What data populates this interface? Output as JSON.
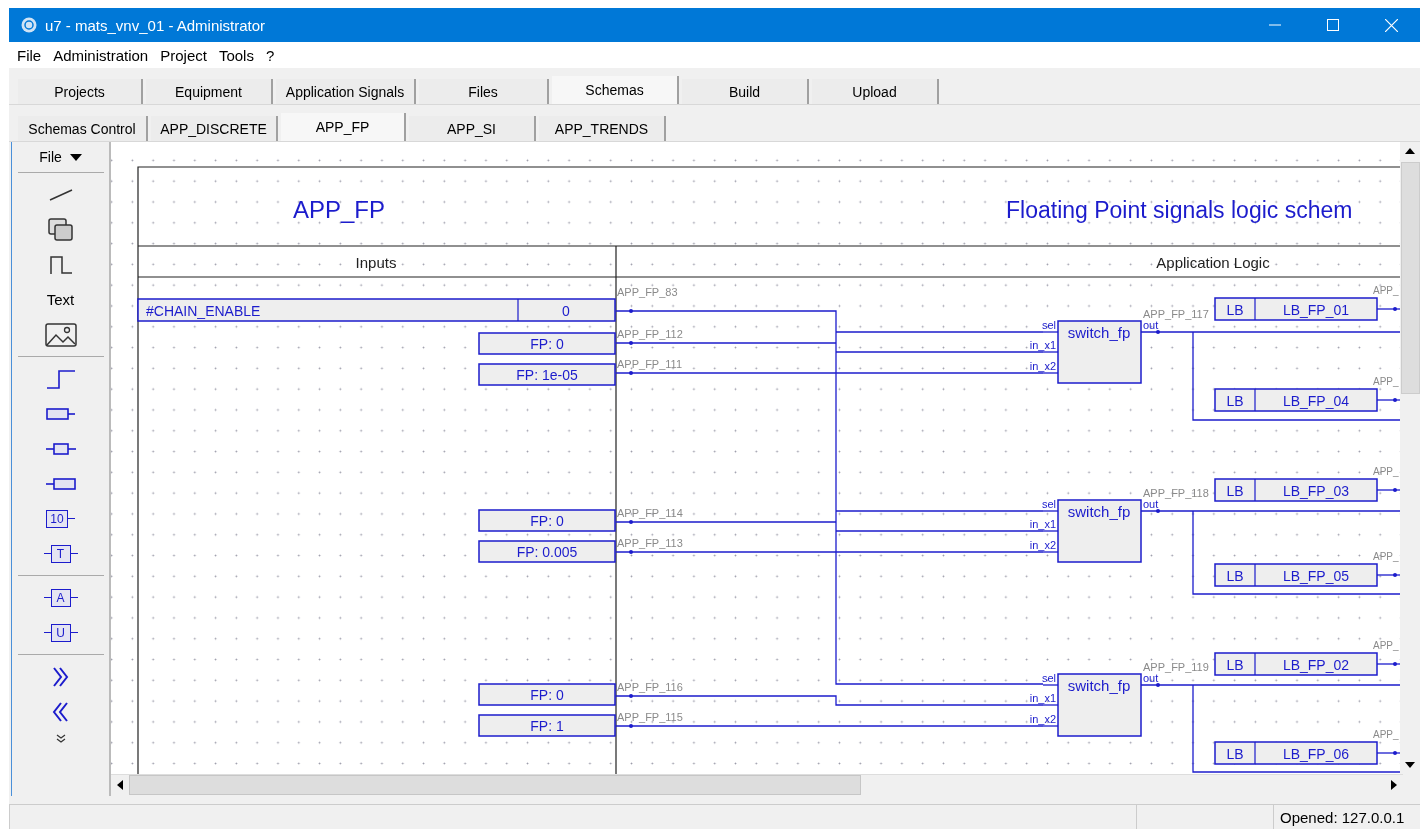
{
  "window": {
    "title": "u7 - mats_vnv_01 - Administrator"
  },
  "menu": [
    "File",
    "Administration",
    "Project",
    "Tools",
    "?"
  ],
  "tabs": [
    {
      "label": "Projects",
      "selected": false
    },
    {
      "label": "Equipment",
      "selected": false
    },
    {
      "label": "Application Signals",
      "selected": false
    },
    {
      "label": "Files",
      "selected": false
    },
    {
      "label": "Schemas",
      "selected": true
    },
    {
      "label": "Build",
      "selected": false
    },
    {
      "label": "Upload",
      "selected": false
    }
  ],
  "subtabs": [
    {
      "label": "Schemas Control",
      "selected": false
    },
    {
      "label": "APP_DISCRETE",
      "selected": false
    },
    {
      "label": "APP_FP",
      "selected": true
    },
    {
      "label": "APP_SI",
      "selected": false
    },
    {
      "label": "APP_TRENDS",
      "selected": false
    }
  ],
  "toolbar": {
    "file_menu": "File",
    "tools": [
      {
        "kind": "line"
      },
      {
        "kind": "rects"
      },
      {
        "kind": "pulse"
      },
      {
        "kind": "text",
        "label": "Text"
      },
      {
        "kind": "image"
      },
      {
        "kind": "separator"
      },
      {
        "kind": "step"
      },
      {
        "kind": "signal_out"
      },
      {
        "kind": "signal_inout"
      },
      {
        "kind": "signal_in"
      },
      {
        "kind": "const",
        "label": "10"
      },
      {
        "kind": "tag",
        "label": "T"
      },
      {
        "kind": "separator"
      },
      {
        "kind": "tag",
        "label": "A"
      },
      {
        "kind": "tag",
        "label": "U"
      },
      {
        "kind": "separator"
      },
      {
        "kind": "forward"
      },
      {
        "kind": "back"
      },
      {
        "kind": "more"
      }
    ]
  },
  "schema": {
    "name": "APP_FP",
    "description": "Floating Point signals logic schem",
    "columns": [
      "Inputs",
      "Application Logic"
    ],
    "enable": {
      "name": "#CHAIN_ENABLE",
      "value": "0",
      "signal": "APP_FP_83"
    },
    "groups": [
      {
        "inputs": [
          {
            "value": "FP: 0",
            "signal": "APP_FP_112"
          },
          {
            "value": "FP: 1e-05",
            "signal": "APP_FP_111"
          }
        ],
        "block": {
          "name": "switch_fp",
          "pins": [
            "sel",
            "in_x1",
            "in_x2"
          ],
          "output_pin": "out"
        },
        "output_signal": "APP_FP_117",
        "receivers": [
          {
            "tag": "LB",
            "name": "LB_FP_01",
            "signal": "APP_"
          },
          {
            "tag": "LB",
            "name": "LB_FP_04",
            "signal": "APP_"
          }
        ]
      },
      {
        "inputs": [
          {
            "value": "FP: 0",
            "signal": "APP_FP_114"
          },
          {
            "value": "FP: 0.005",
            "signal": "APP_FP_113"
          }
        ],
        "block": {
          "name": "switch_fp",
          "pins": [
            "sel",
            "in_x1",
            "in_x2"
          ],
          "output_pin": "out"
        },
        "output_signal": "APP_FP_118",
        "receivers": [
          {
            "tag": "LB",
            "name": "LB_FP_03",
            "signal": "APP_"
          },
          {
            "tag": "LB",
            "name": "LB_FP_05",
            "signal": "APP_"
          }
        ]
      },
      {
        "inputs": [
          {
            "value": "FP: 0",
            "signal": "APP_FP_116"
          },
          {
            "value": "FP: 1",
            "signal": "APP_FP_115"
          }
        ],
        "block": {
          "name": "switch_fp",
          "pins": [
            "sel",
            "in_x1",
            "in_x2"
          ],
          "output_pin": "out"
        },
        "output_signal": "APP_FP_119",
        "receivers": [
          {
            "tag": "LB",
            "name": "LB_FP_02",
            "signal": "APP_"
          },
          {
            "tag": "LB",
            "name": "LB_FP_06",
            "signal": "APP_"
          }
        ]
      }
    ]
  },
  "status_bar": {
    "panes": [
      "Opened: 127.0.0.1"
    ]
  }
}
